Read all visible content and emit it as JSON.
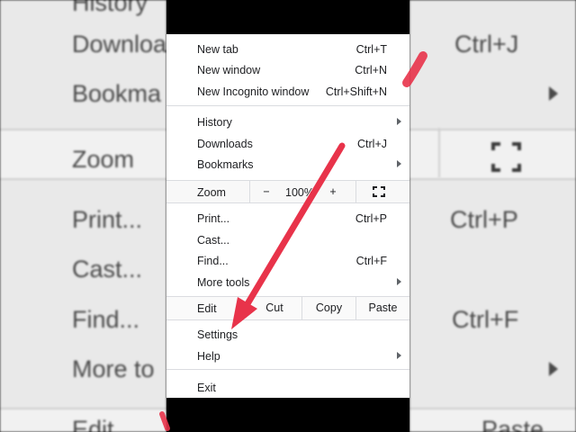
{
  "background": {
    "left": {
      "history": "History",
      "downloads": "Downloa",
      "bookmarks": "Bookma",
      "zoom": "Zoom",
      "print": "Print...",
      "cast": "Cast...",
      "find": "Find...",
      "more_tools": "More to",
      "edit": "Edit"
    },
    "right": {
      "downloads_shortcut": "Ctrl+J",
      "print_shortcut": "Ctrl+P",
      "find_shortcut": "Ctrl+F",
      "paste": "Paste"
    }
  },
  "menu": {
    "new_tab": {
      "label": "New tab",
      "shortcut": "Ctrl+T"
    },
    "new_window": {
      "label": "New window",
      "shortcut": "Ctrl+N"
    },
    "new_incognito": {
      "label": "New Incognito window",
      "shortcut": "Ctrl+Shift+N"
    },
    "history": {
      "label": "History"
    },
    "downloads": {
      "label": "Downloads",
      "shortcut": "Ctrl+J"
    },
    "bookmarks": {
      "label": "Bookmarks"
    },
    "zoom": {
      "label": "Zoom",
      "minus": "−",
      "value": "100%",
      "plus": "+"
    },
    "print": {
      "label": "Print...",
      "shortcut": "Ctrl+P"
    },
    "cast": {
      "label": "Cast..."
    },
    "find": {
      "label": "Find...",
      "shortcut": "Ctrl+F"
    },
    "more_tools": {
      "label": "More tools"
    },
    "edit": {
      "label": "Edit",
      "cut": "Cut",
      "copy": "Copy",
      "paste": "Paste"
    },
    "settings": {
      "label": "Settings"
    },
    "help": {
      "label": "Help"
    },
    "exit": {
      "label": "Exit"
    }
  },
  "colors": {
    "arrow": "#e8334a",
    "menu_bg": "#ffffff",
    "divider": "#dadce0"
  }
}
